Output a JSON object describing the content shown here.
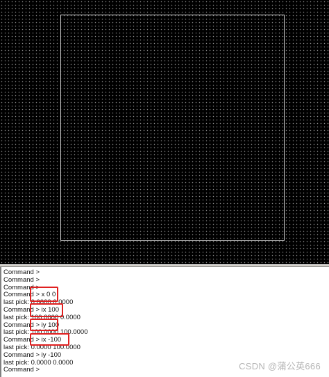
{
  "console": {
    "lines": [
      "Command >",
      "Command >",
      "Command >",
      "Command > x 0 0",
      "last pick:  0.0000 0.0000",
      "Command > ix 100",
      "last pick:  100.0000 0.0000",
      "Command > iy 100",
      "last pick:  100.0000 100.0000",
      "Command > ix -100",
      "last pick:  0.0000 100.0000",
      "Command > iy -100",
      "last pick:  0.0000 0.0000",
      "Command >"
    ]
  },
  "watermark": "CSDN @蒲公英666",
  "colors": {
    "canvas_bg": "#000000",
    "grid_dot": "#8a8a8a",
    "outline": "#cfcfcf",
    "highlight": "#e02020",
    "console_bg": "#ffffff"
  }
}
